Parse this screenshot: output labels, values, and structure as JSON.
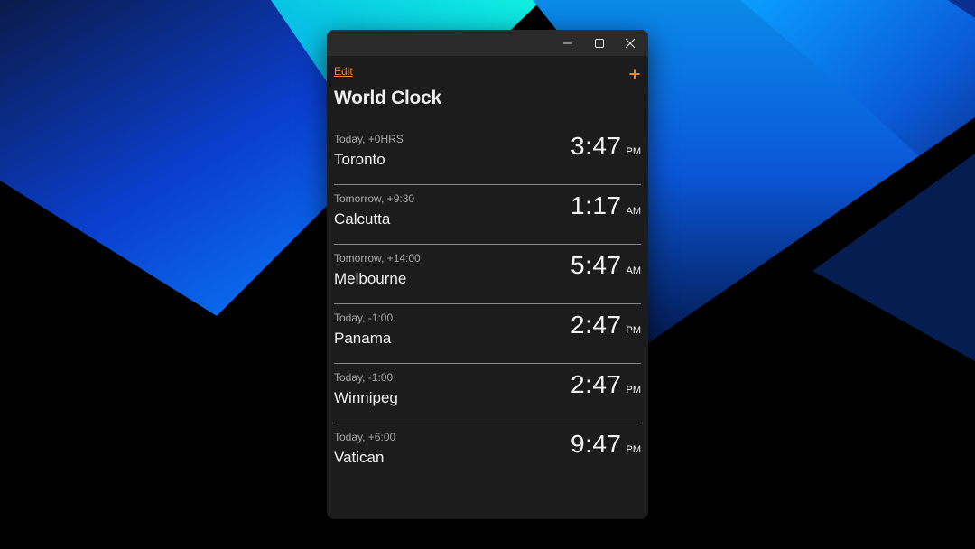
{
  "window": {
    "header": {
      "edit_label": "Edit",
      "add_icon": "plus-icon",
      "title": "World Clock"
    },
    "caption_icons": [
      "minimize-icon",
      "maximize-icon",
      "close-icon"
    ]
  },
  "clocks": [
    {
      "offset": "Today, +0HRS",
      "city": "Toronto",
      "time": "3:47",
      "ampm": "PM"
    },
    {
      "offset": "Tomorrow, +9:30",
      "city": "Calcutta",
      "time": "1:17",
      "ampm": "AM"
    },
    {
      "offset": "Tomorrow, +14:00",
      "city": "Melbourne",
      "time": "5:47",
      "ampm": "AM"
    },
    {
      "offset": "Today, -1:00",
      "city": "Panama",
      "time": "2:47",
      "ampm": "PM"
    },
    {
      "offset": "Today, -1:00",
      "city": "Winnipeg",
      "time": "2:47",
      "ampm": "PM"
    },
    {
      "offset": "Today, +6:00",
      "city": "Vatican",
      "time": "9:47",
      "ampm": "PM"
    }
  ],
  "colors": {
    "accent": "#e8872e",
    "window_bg": "#1c1c1c",
    "titlebar_bg": "#2b2b2b",
    "divider": "#8a8a8a"
  }
}
